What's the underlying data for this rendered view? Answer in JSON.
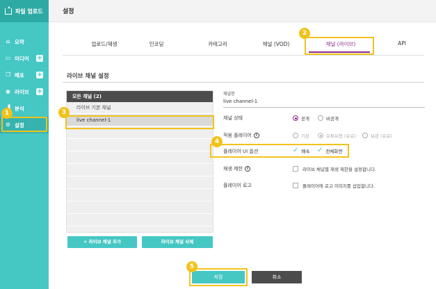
{
  "sidebar": {
    "upload_label": "파일 업로드",
    "items": [
      {
        "label": "요약",
        "icon": "home-icon",
        "plus": false
      },
      {
        "label": "미디어",
        "icon": "media-icon",
        "plus": true
      },
      {
        "label": "배포",
        "icon": "deploy-icon",
        "plus": true
      },
      {
        "label": "라이브",
        "icon": "live-icon",
        "plus": true
      },
      {
        "label": "분석",
        "icon": "analytics-icon",
        "plus": false
      },
      {
        "label": "설정",
        "icon": "settings-icon",
        "plus": false
      }
    ]
  },
  "header": {
    "title": "설정"
  },
  "tabs": [
    {
      "label": "업로드/재생"
    },
    {
      "label": "인코딩"
    },
    {
      "label": "카테고리"
    },
    {
      "label": "채널 (VOD)"
    },
    {
      "label": "채널 (라이브)"
    },
    {
      "label": "API"
    }
  ],
  "section_title": "라이브 채널 설정",
  "channel_list": {
    "header": "모든 채널 (2)",
    "rows": [
      "라이브 기본 채널",
      "live channel-1"
    ]
  },
  "list_buttons": {
    "add": "+ 라이브 채널 추가",
    "delete": "라이브 채널 삭제"
  },
  "form": {
    "name_label": "채널명",
    "name_value": "live channel-1",
    "status_label": "채널 상태",
    "status_options": [
      "공개",
      "비공개"
    ],
    "player_label": "적용 플레이어",
    "player_options": [
      "기본",
      "유튜브형 (유료)",
      "보관 (유료)"
    ],
    "ui_label": "플레이어 UI 옵션",
    "ui_options": [
      "배속",
      "전체화면"
    ],
    "limit_label": "재생 제한",
    "limit_text": "라이브 채널별 재생 제한을 설정합니다.",
    "logo_label": "플레이어 로고",
    "logo_text": "플레이어에 로고 이미지를 삽입합니다."
  },
  "buttons": {
    "save": "저장",
    "cancel": "취소"
  },
  "badges": [
    "1",
    "2",
    "3",
    "4",
    "5"
  ],
  "colors": {
    "accent": "#45c7c4",
    "highlight": "#f2c21b",
    "active_tab": "#8e2a8a"
  }
}
